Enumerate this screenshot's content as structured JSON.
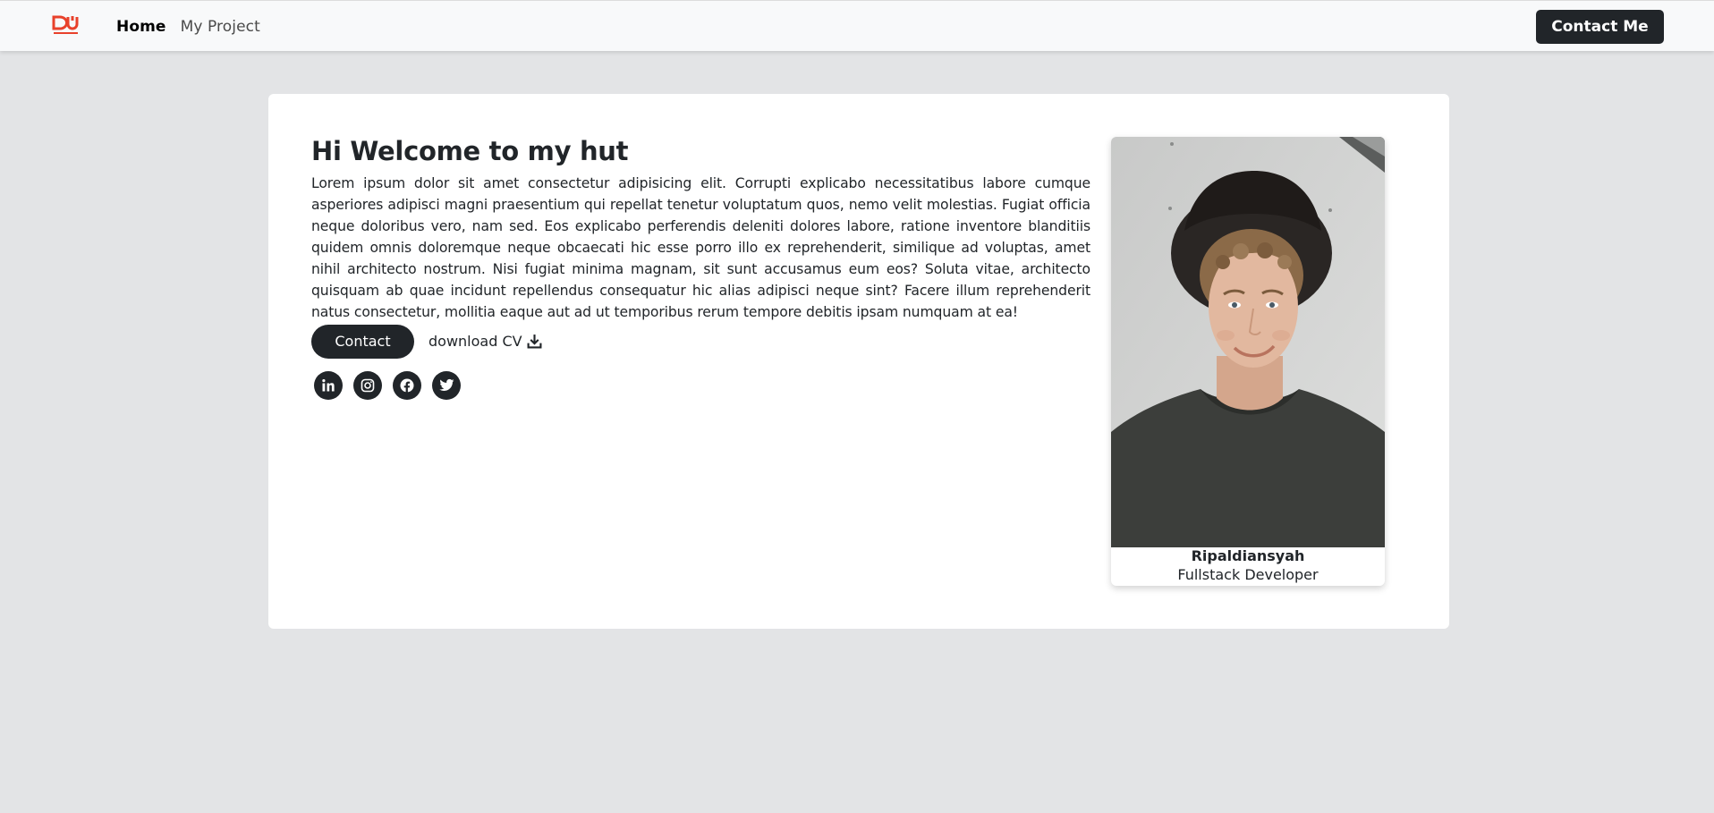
{
  "navbar": {
    "logo_icon": "du-logo-icon",
    "logo_color": "#e8412b",
    "links": [
      {
        "label": "Home",
        "active": true
      },
      {
        "label": "My Project",
        "active": false
      }
    ],
    "contact_button": "Contact Me"
  },
  "hero": {
    "heading": "Hi Welcome to my hut",
    "paragraph": "Lorem ipsum dolor sit amet consectetur adipisicing elit. Corrupti explicabo necessitatibus labore cumque asperiores adipisci magni praesentium qui repellat tenetur voluptatum quos, nemo velit molestias. Fugiat officia neque doloribus vero, nam sed. Eos explicabo perferendis deleniti dolores labore, ratione inventore blanditiis quidem omnis doloremque neque obcaecati hic esse porro illo ex reprehenderit, similique ad voluptas, amet nihil architecto nostrum. Nisi fugiat minima magnam, sit sunt accusamus eum eos? Soluta vitae, architecto quisquam ab quae incidunt repellendus consequatur hic alias adipisci neque sint? Facere illum reprehenderit natus consectetur, mollitia eaque aut ad ut temporibus rerum tempore debitis ipsam numquam at ea!",
    "contact_button": "Contact",
    "download_label": "download CV",
    "download_icon": "download-icon",
    "socials": [
      "linkedin-icon",
      "instagram-icon",
      "facebook-icon",
      "twitter-icon"
    ]
  },
  "profile": {
    "name": "Ripaldiansyah",
    "role": "Fullstack Developer"
  },
  "colors": {
    "page_background": "#e3e4e6",
    "dark": "#212529",
    "navbar": "#f8f9fa"
  }
}
